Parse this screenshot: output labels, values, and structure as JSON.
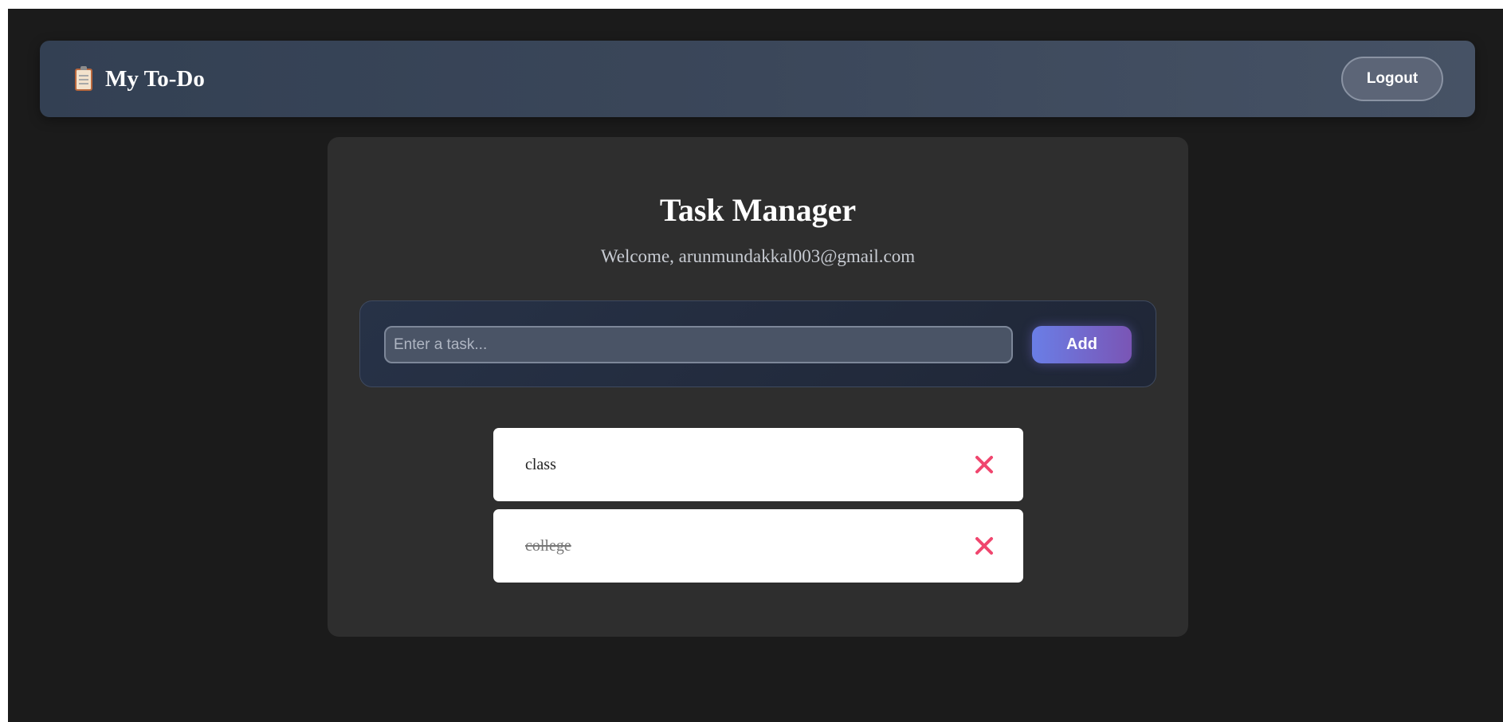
{
  "navbar": {
    "brand_icon": "clipboard-icon",
    "brand_title": "My To-Do",
    "logout_label": "Logout"
  },
  "main": {
    "title": "Task Manager",
    "welcome": "Welcome, arunmundakkal003@gmail.com",
    "input": {
      "value": "",
      "placeholder": "Enter a task..."
    },
    "add_label": "Add",
    "tasks": [
      {
        "text": "class",
        "completed": false,
        "delete_icon": "close-icon"
      },
      {
        "text": "college",
        "completed": true,
        "delete_icon": "close-icon"
      }
    ]
  },
  "colors": {
    "background": "#1b1b1b",
    "card": "#2e2e2e",
    "delete_accent": "#f0466e",
    "add_gradient_start": "#6a7ee6",
    "add_gradient_end": "#7a55b5"
  }
}
